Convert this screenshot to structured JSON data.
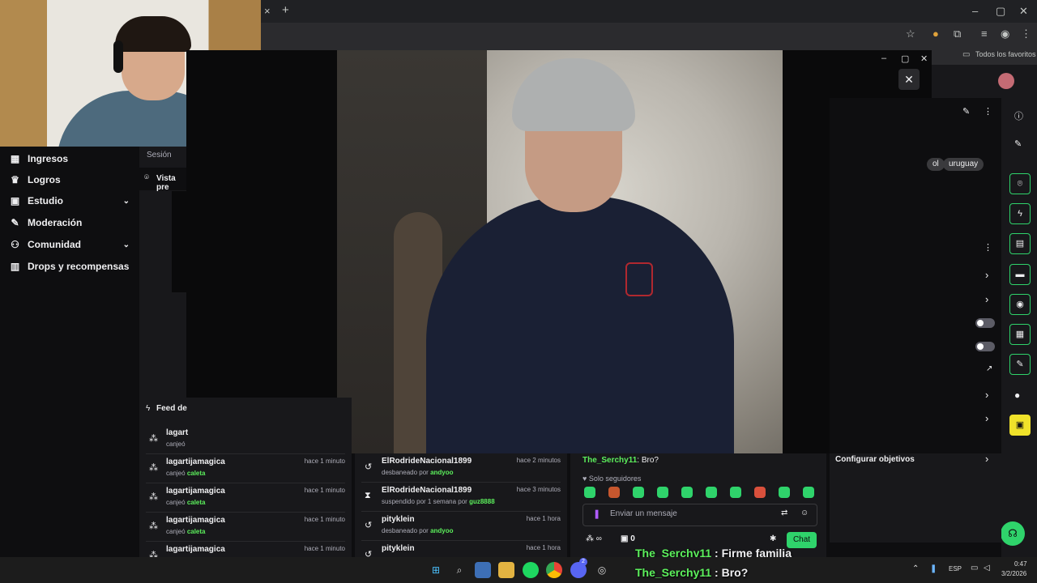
{
  "browser": {
    "bookmark_folder": "Todos los favoritos",
    "new_tab": "+",
    "close_tab": "×"
  },
  "sidebar": {
    "items": [
      {
        "label": "Ingresos",
        "icon": "chart-icon",
        "chevron": false
      },
      {
        "label": "Logros",
        "icon": "trophy-icon",
        "chevron": false
      },
      {
        "label": "Estudio",
        "icon": "studio-icon",
        "chevron": true
      },
      {
        "label": "Moderación",
        "icon": "wrench-icon",
        "chevron": false
      },
      {
        "label": "Comunidad",
        "icon": "people-icon",
        "chevron": true
      },
      {
        "label": "Drops y recompensas",
        "icon": "gift-icon",
        "chevron": false
      }
    ]
  },
  "col2": {
    "session_label": "Sesión",
    "preview_label": "Vista pre"
  },
  "right_panel": {
    "tags": [
      "ol",
      "uruguay"
    ],
    "configure_goals": "Configurar objetivos"
  },
  "feed": {
    "title": "Feed de",
    "activity": [
      {
        "user": "lagart",
        "action": "canjeó",
        "item": "",
        "time": ""
      },
      {
        "user": "lagartijamagica",
        "action": "canjeó",
        "item": "caleta",
        "time": "hace 1 minuto"
      },
      {
        "user": "lagartijamagica",
        "action": "canjeó",
        "item": "caleta",
        "time": "hace 1 minuto"
      },
      {
        "user": "lagartijamagica",
        "action": "canjeó",
        "item": "caleta",
        "time": "hace 1 minuto"
      },
      {
        "user": "lagartijamagica",
        "action": "",
        "item": "",
        "time": "hace 1 minuto"
      }
    ]
  },
  "mod_log": [
    {
      "user": "ElRodrideNacional1899",
      "text": "desbaneado por ",
      "by": "andyoo",
      "time": "hace 2 minutos",
      "icon": "undo-icon"
    },
    {
      "user": "ElRodrideNacional1899",
      "text": "suspendido por 1 semana por ",
      "by": "guz8888",
      "time": "hace 3 minutos",
      "icon": "hourglass-icon"
    },
    {
      "user": "pityklein",
      "text": "desbaneado por ",
      "by": "andyoo",
      "time": "hace 1 hora",
      "icon": "undo-icon"
    },
    {
      "user": "pityklein",
      "text": "",
      "by": "",
      "time": "hace 1 hora",
      "icon": "undo-icon"
    }
  ],
  "chat": {
    "last_message_user": "The_Serchy11",
    "last_message_text": "Bro?",
    "followers_only": "Solo seguidores",
    "input_placeholder": "Enviar un mensaje",
    "points": "0",
    "infinity": "∞",
    "send_button": "Chat"
  },
  "stream_overlay": [
    {
      "user": "The_Serchy11",
      "text": " : Firme familia"
    },
    {
      "user": "The_Serchy11",
      "text": " : Bro?"
    }
  ],
  "taskbar": {
    "language": "ESP",
    "time": "0:47",
    "date": "3/2/2026",
    "discord_badge": "2"
  },
  "colors": {
    "accent": "#2fd36b",
    "username_green": "#5cf05c",
    "background": "#0e0e10"
  }
}
